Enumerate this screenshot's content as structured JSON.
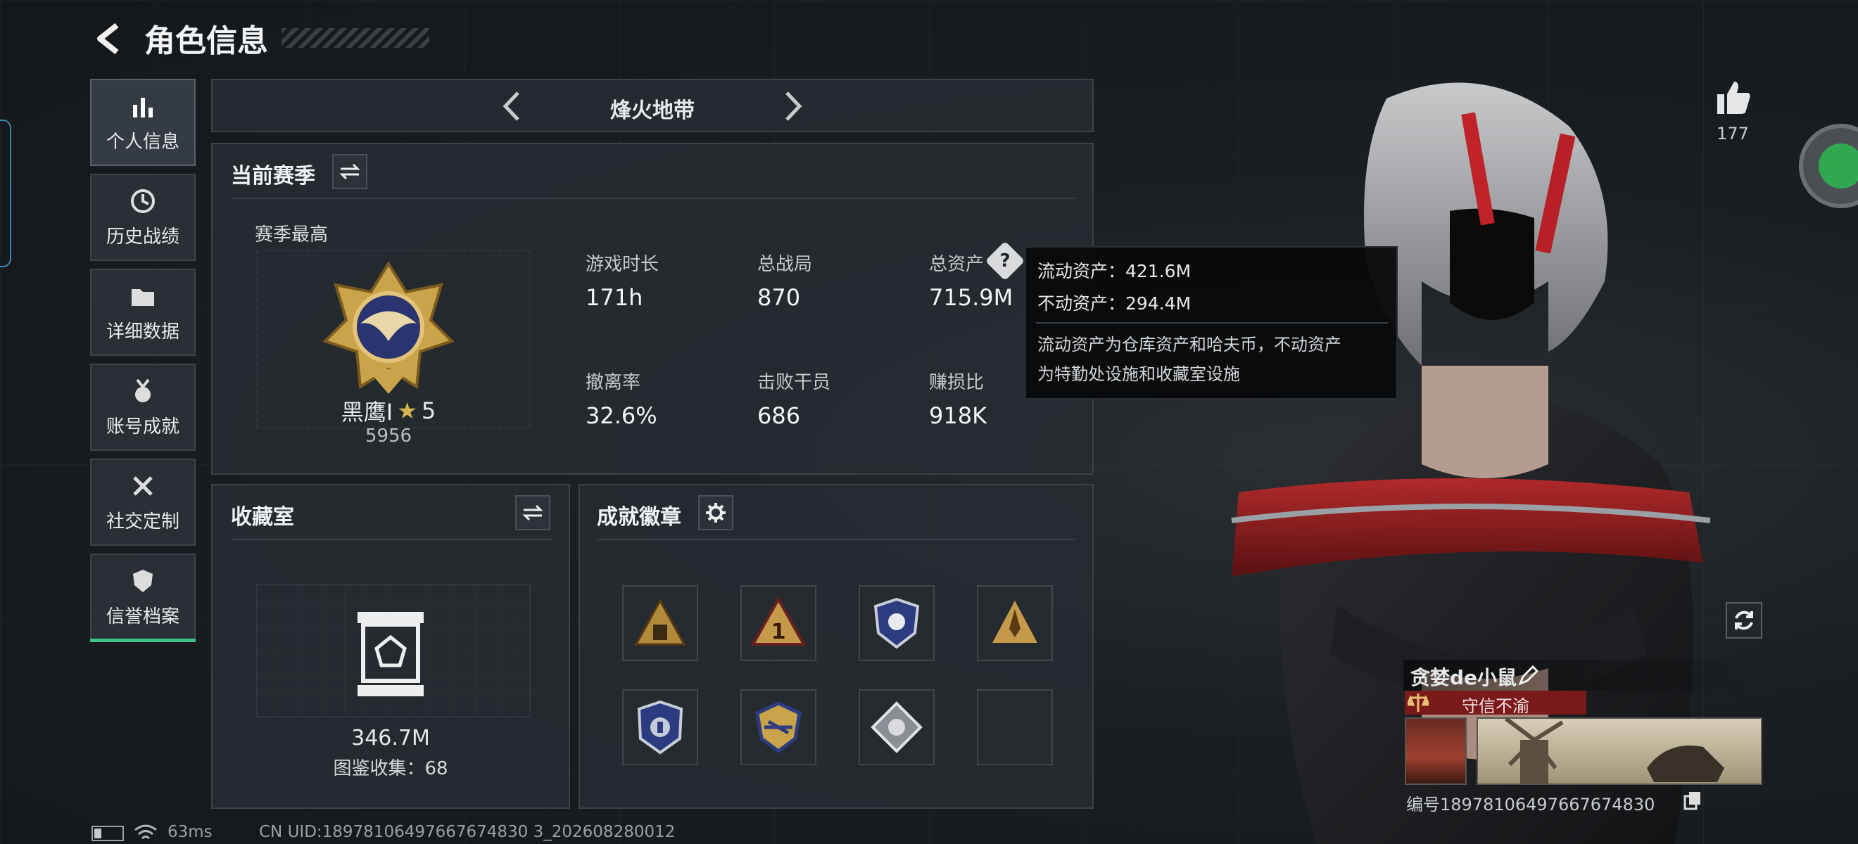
{
  "header": {
    "title": "角色信息"
  },
  "nav": [
    {
      "label": "个人信息",
      "icon": "bar-chart-icon",
      "active": true
    },
    {
      "label": "历史战绩",
      "icon": "clock-icon"
    },
    {
      "label": "详细数据",
      "icon": "folder-icon"
    },
    {
      "label": "账号成就",
      "icon": "medal-icon"
    },
    {
      "label": "社交定制",
      "icon": "tools-icon"
    },
    {
      "label": "信誉档案",
      "icon": "shield-icon"
    }
  ],
  "mode_selector": {
    "label": "烽火地带"
  },
  "season": {
    "title": "当前赛季",
    "best_label": "赛季最高",
    "rank_name": "黑鹰I",
    "rank_stars": "5",
    "rank_score": "5956",
    "stats": [
      {
        "label": "游戏时长",
        "value": "171h"
      },
      {
        "label": "总战局",
        "value": "870"
      },
      {
        "label": "总资产",
        "value": "715.9M"
      },
      {
        "label": "撤离率",
        "value": "32.6%"
      },
      {
        "label": "击败干员",
        "value": "686"
      },
      {
        "label": "赚损比",
        "value": "918K"
      }
    ]
  },
  "tooltip": {
    "liquid": "流动资产：421.6M",
    "fixed": "不动资产：294.4M",
    "desc_line1": "流动资产为仓库资产和哈夫币，不动资产",
    "desc_line2": "为特勤处设施和收藏室设施"
  },
  "collection": {
    "title": "收藏室",
    "value": "346.7M",
    "count_label": "图鉴收集：68"
  },
  "badges": {
    "title": "成就徽章"
  },
  "profile": {
    "likes": "177",
    "player_name": "贪婪de小鼠",
    "title_tag": "守信不渝",
    "uid_label": "编号18978106497667674830"
  },
  "status": {
    "ping": "63ms",
    "uid": "CN UID:18978106497667674830 3_202608280012"
  },
  "colors": {
    "accent_red": "#8a1c1c",
    "panel_bg": "#262b31",
    "gold": "#c9a44a"
  }
}
